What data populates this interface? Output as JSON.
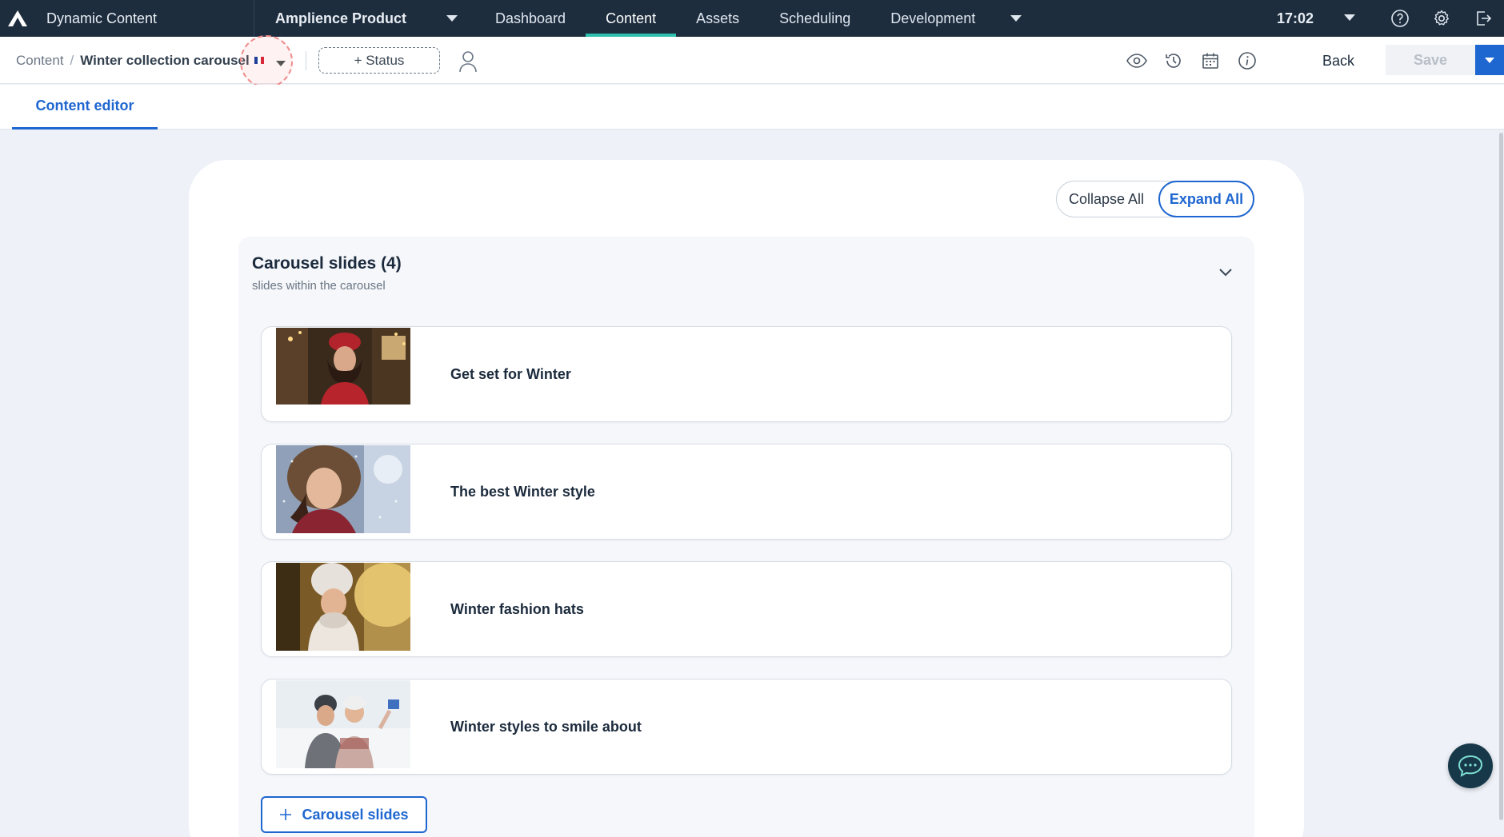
{
  "topnav": {
    "app_title": "Dynamic Content",
    "hub": "Amplience Product",
    "items": [
      {
        "label": "Dashboard",
        "active": false
      },
      {
        "label": "Content",
        "active": true
      },
      {
        "label": "Assets",
        "active": false
      },
      {
        "label": "Scheduling",
        "active": false
      },
      {
        "label": "Development",
        "active": false
      }
    ],
    "time": "17:02",
    "icons": [
      "help-icon",
      "settings-icon",
      "logout-icon"
    ]
  },
  "toolbar": {
    "breadcrumb": {
      "root": "Content",
      "separator": "/",
      "current": "Winter collection carousel"
    },
    "locale_flag": [
      "#1f3f99",
      "#ffffff",
      "#d8283a"
    ],
    "status_label": "+ Status",
    "icons": [
      "preview-eye-icon",
      "history-icon",
      "calendar-icon",
      "info-icon"
    ],
    "back_label": "Back",
    "save_label": "Save"
  },
  "tabs": {
    "content_editor": "Content editor"
  },
  "editor": {
    "collapse_all": "Collapse All",
    "expand_all": "Expand All",
    "section": {
      "title": "Carousel slides (4)",
      "subtitle": "slides within the carousel",
      "slides": [
        {
          "label": "Get set for Winter"
        },
        {
          "label": "The best Winter style"
        },
        {
          "label": "Winter fashion hats"
        },
        {
          "label": "Winter styles to smile about"
        }
      ],
      "add_label": "Carousel slides"
    }
  },
  "colors": {
    "nav_bg": "#1d2d3e",
    "accent": "#1e66d0",
    "active_tab": "#2fc0b0"
  }
}
